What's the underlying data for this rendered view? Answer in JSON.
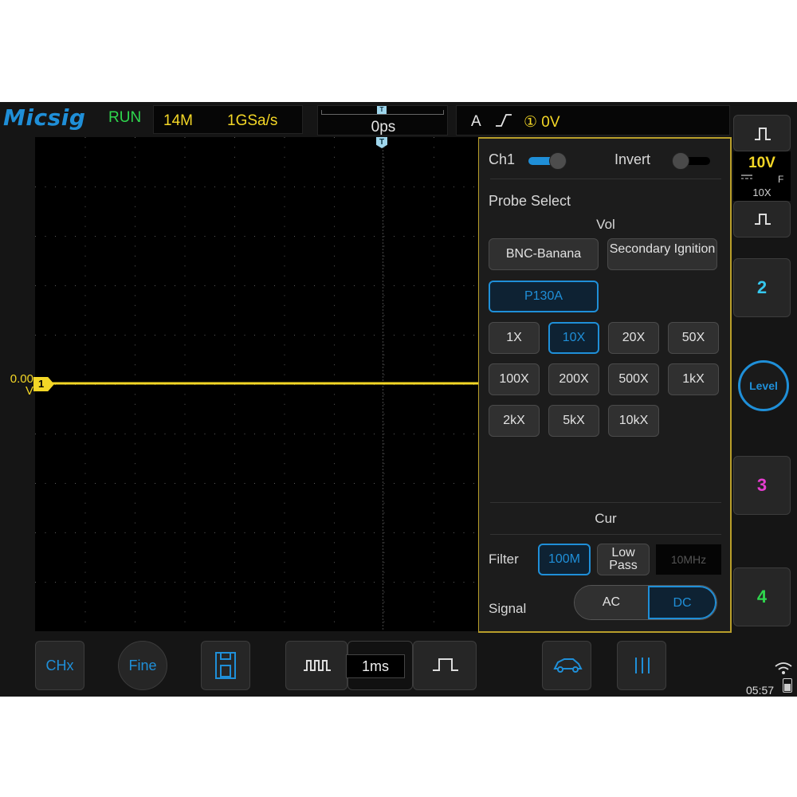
{
  "top_bar": {
    "logo": "Micsig",
    "run_state": "RUN",
    "memory_depth": "14M",
    "sample_rate": "1GSa/s",
    "time_marker": "T",
    "horizontal_delay": "0ps",
    "trigger_source": "A",
    "trigger_edge": "∕",
    "trigger_level": "① 0V"
  },
  "grid": {
    "trigger_marker": "T",
    "ch1_offset_label_value": "0.00",
    "ch1_offset_label_unit": "V",
    "ch1_marker": "1",
    "ch1_color": "#f4d726"
  },
  "right_panel": {
    "ch1_scale": "10V",
    "ch1_coupling_icon": "dc-coupling-icon",
    "ch1_bw": "F",
    "ch1_probe": "10X",
    "ch2_label": "2",
    "ch3_label": "3",
    "ch4_label": "4",
    "level_label": "Level",
    "ch2_color": "#35c8ef",
    "ch3_color": "#e53dd0",
    "ch4_color": "#2fd64d",
    "time": "05:57"
  },
  "bottom_bar": {
    "chx_label": "CHx",
    "fine_label": "Fine",
    "timebase": "1ms"
  },
  "probe_panel": {
    "ch_label": "Ch1",
    "ch_enabled": true,
    "invert_label": "Invert",
    "invert_enabled": false,
    "probe_select_label": "Probe Select",
    "vol_label": "Vol",
    "probe_types": [
      "BNC-Banana",
      "Secondary Ignition",
      "P130A"
    ],
    "selected_probe_type": "P130A",
    "ratios": [
      "1X",
      "10X",
      "20X",
      "50X",
      "100X",
      "200X",
      "500X",
      "1kX",
      "2kX",
      "5kX",
      "10kX"
    ],
    "selected_ratio": "10X",
    "cur_label": "Cur",
    "filter_label": "Filter",
    "filter_100m": "100M",
    "filter_lowpass": "Low Pass",
    "filter_freq": "10MHz",
    "signal_label": "Signal",
    "signal_ac": "AC",
    "signal_dc": "DC",
    "selected_signal": "DC"
  }
}
